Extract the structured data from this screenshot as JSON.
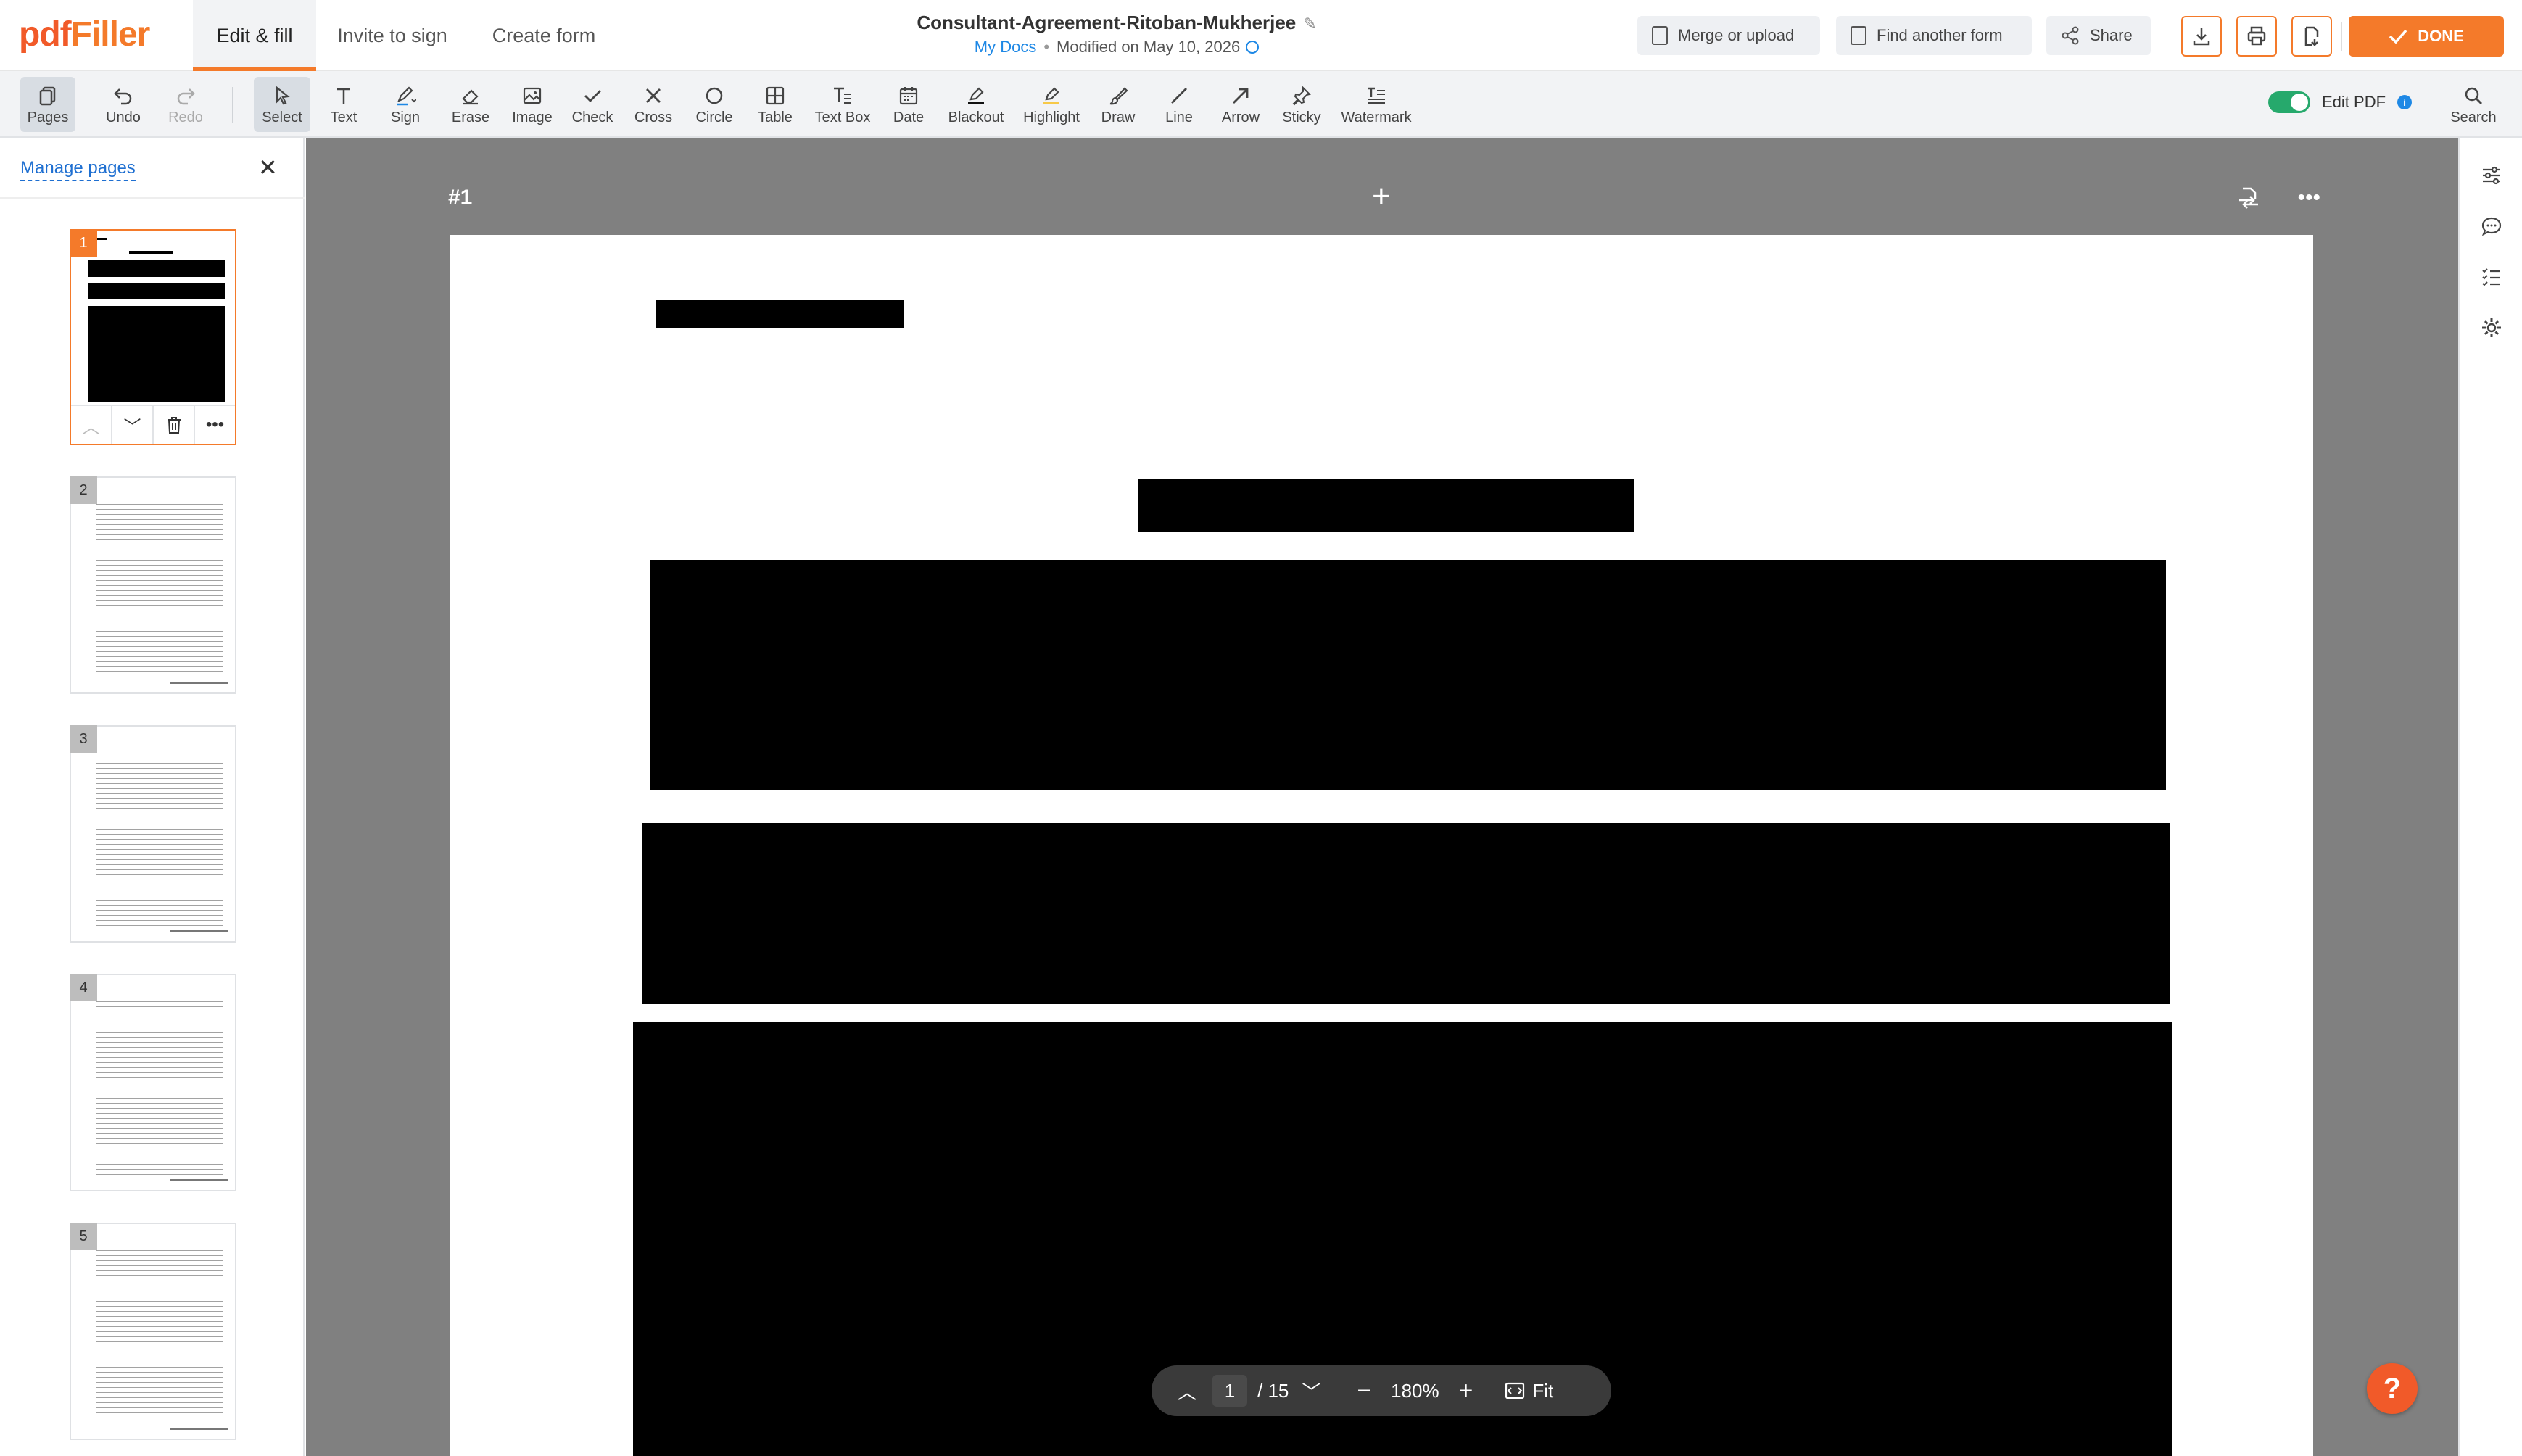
{
  "logo": {
    "text_a": "pdf",
    "text_b": "Filler"
  },
  "header": {
    "tabs": [
      {
        "label": "Edit & fill",
        "active": true
      },
      {
        "label": "Invite to sign",
        "active": false
      },
      {
        "label": "Create form",
        "active": false
      }
    ],
    "doc_title": "Consultant-Agreement-Ritoban-Mukherjee",
    "breadcrumb_link": "My Docs",
    "modified": "Modified on May 10, 2026",
    "buttons": {
      "merge": "Merge or upload",
      "find": "Find another form",
      "share": "Share",
      "done": "DONE"
    },
    "icon_buttons": [
      "download-icon",
      "print-icon",
      "export-icon"
    ]
  },
  "toolbar": {
    "tools": [
      {
        "id": "pages",
        "label": "Pages",
        "icon": "pages-icon",
        "state": "active"
      },
      {
        "id": "undo",
        "label": "Undo",
        "icon": "undo-icon",
        "state": "normal"
      },
      {
        "id": "redo",
        "label": "Redo",
        "icon": "redo-icon",
        "state": "disabled"
      },
      {
        "id": "select",
        "label": "Select",
        "icon": "cursor-icon",
        "state": "active"
      },
      {
        "id": "text",
        "label": "Text",
        "icon": "text-icon",
        "state": "normal"
      },
      {
        "id": "sign",
        "label": "Sign",
        "icon": "pen-icon",
        "state": "normal"
      },
      {
        "id": "erase",
        "label": "Erase",
        "icon": "eraser-icon",
        "state": "normal"
      },
      {
        "id": "image",
        "label": "Image",
        "icon": "image-icon",
        "state": "normal"
      },
      {
        "id": "check",
        "label": "Check",
        "icon": "check-icon",
        "state": "normal"
      },
      {
        "id": "cross",
        "label": "Cross",
        "icon": "cross-icon",
        "state": "normal"
      },
      {
        "id": "circle",
        "label": "Circle",
        "icon": "circle-icon",
        "state": "normal"
      },
      {
        "id": "table",
        "label": "Table",
        "icon": "table-icon",
        "state": "normal"
      },
      {
        "id": "textbox",
        "label": "Text Box",
        "icon": "textbox-icon",
        "state": "normal"
      },
      {
        "id": "date",
        "label": "Date",
        "icon": "calendar-icon",
        "state": "normal"
      },
      {
        "id": "blackout",
        "label": "Blackout",
        "icon": "blackout-icon",
        "state": "normal"
      },
      {
        "id": "highlight",
        "label": "Highlight",
        "icon": "highlighter-icon",
        "state": "normal"
      },
      {
        "id": "draw",
        "label": "Draw",
        "icon": "brush-icon",
        "state": "normal"
      },
      {
        "id": "line",
        "label": "Line",
        "icon": "line-icon",
        "state": "normal"
      },
      {
        "id": "arrow",
        "label": "Arrow",
        "icon": "arrow-icon",
        "state": "normal"
      },
      {
        "id": "sticky",
        "label": "Sticky",
        "icon": "pin-icon",
        "state": "normal"
      },
      {
        "id": "watermark",
        "label": "Watermark",
        "icon": "watermark-icon",
        "state": "normal"
      }
    ],
    "edit_pdf_label": "Edit PDF",
    "edit_pdf_enabled": true,
    "search_label": "Search"
  },
  "sidebar": {
    "manage_pages": "Manage pages",
    "thumbnails": [
      {
        "number": "1",
        "selected": true
      },
      {
        "number": "2",
        "selected": false
      },
      {
        "number": "3",
        "selected": false
      },
      {
        "number": "4",
        "selected": false
      },
      {
        "number": "5",
        "selected": false
      }
    ]
  },
  "canvas": {
    "page_label": "#1"
  },
  "pager": {
    "current_page": "1",
    "total": "/ 15",
    "zoom": "180%",
    "fit_label": "Fit"
  },
  "help": {
    "label": "?"
  },
  "colors": {
    "accent": "#f47a2a",
    "brand": "#f15a29",
    "link": "#1e88e5",
    "toggle_on": "#26a96c",
    "canvas_bg": "#808080"
  }
}
